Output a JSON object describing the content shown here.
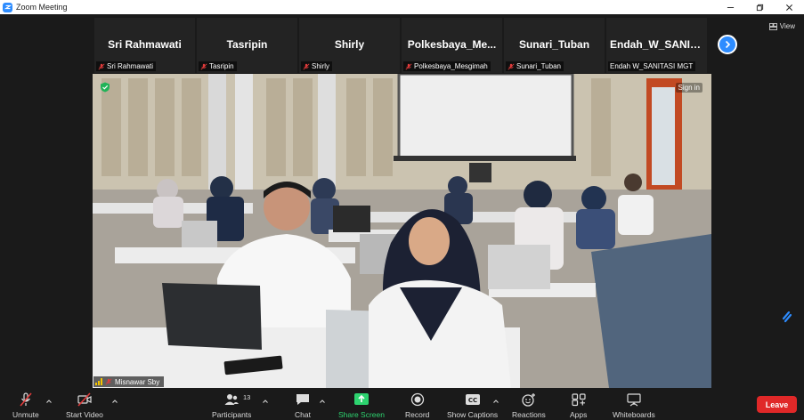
{
  "window": {
    "title": "Zoom Meeting"
  },
  "view_label": "View",
  "participants_strip": [
    {
      "display_name": "Sri Rahmawati",
      "tag": "Sri Rahmawati",
      "muted": true
    },
    {
      "display_name": "Tasripin",
      "tag": "Tasripin",
      "muted": true
    },
    {
      "display_name": "Shirly",
      "tag": "Shirly",
      "muted": true
    },
    {
      "display_name": "Polkesbaya_Me...",
      "tag": "Polkesbaya_Mesgimah",
      "muted": true
    },
    {
      "display_name": "Sunari_Tuban",
      "tag": "Sunari_Tuban",
      "muted": true
    },
    {
      "display_name": "Endah_W_SANIT...",
      "tag": "Endah W_SANITASI MGT",
      "muted": false
    }
  ],
  "main_video": {
    "speaker_name": "Misnawar Sby",
    "sign_in_label": "Sign in"
  },
  "toolbar": {
    "unmute": "Unmute",
    "start_video": "Start Video",
    "participants": "Participants",
    "participants_count": "13",
    "chat": "Chat",
    "share_screen": "Share Screen",
    "record": "Record",
    "captions": "Show Captions",
    "reactions": "Reactions",
    "apps": "Apps",
    "whiteboards": "Whiteboards",
    "leave": "Leave"
  },
  "colors": {
    "accent": "#2d8cff",
    "share_green": "#2dd36f",
    "leave_red": "#e02828",
    "mute_red": "#e03b3b"
  }
}
